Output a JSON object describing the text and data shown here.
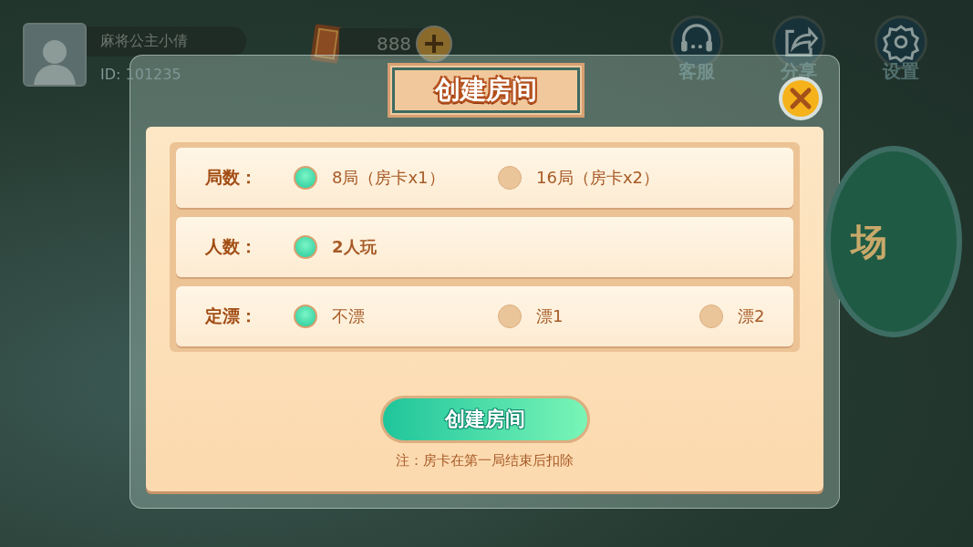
{
  "player": {
    "name": "麻将公主小倩",
    "id_label": "ID: 101235"
  },
  "room_cards": {
    "count": "888"
  },
  "top_buttons": [
    {
      "kind": "headset",
      "label": "客服"
    },
    {
      "kind": "share",
      "label": "分享"
    },
    {
      "kind": "settings",
      "label": "设置"
    }
  ],
  "background_sign": "场",
  "dialog": {
    "title": "创建房间",
    "rows": [
      {
        "label": "局数：",
        "options": [
          {
            "text": "8局（房卡x1）",
            "selected": true
          },
          {
            "text": "16局（房卡x2）",
            "selected": false
          }
        ]
      },
      {
        "label": "人数：",
        "options": [
          {
            "text": "2人玩",
            "selected": true
          }
        ]
      },
      {
        "label": "定漂：",
        "options": [
          {
            "text": "不漂",
            "selected": true
          },
          {
            "text": "漂1",
            "selected": false
          },
          {
            "text": "漂2",
            "selected": false
          }
        ]
      }
    ],
    "create_button": "创建房间",
    "note": "注：房卡在第一局结束后扣除"
  }
}
